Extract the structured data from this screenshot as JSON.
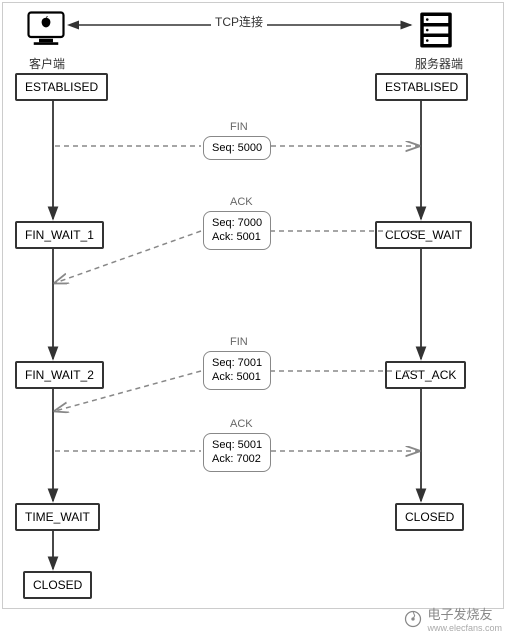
{
  "header": {
    "tcp_label": "TCP连接",
    "client_label": "客户端",
    "server_label": "服务器端"
  },
  "client_states": {
    "s0": "ESTABLISED",
    "s1": "FIN_WAIT_1",
    "s2": "FIN_WAIT_2",
    "s3": "TIME_WAIT",
    "s4": "CLOSED"
  },
  "server_states": {
    "s0": "ESTABLISED",
    "s1": "CLOSE_WAIT",
    "s2": "LAST_ACK",
    "s3": "CLOSED"
  },
  "messages": {
    "m1": {
      "flag": "FIN",
      "line1": "Seq: 5000"
    },
    "m2": {
      "flag": "ACK",
      "line1": "Seq: 7000",
      "line2": "Ack: 5001"
    },
    "m3": {
      "flag": "FIN",
      "line1": "Seq: 7001",
      "line2": "Ack: 5001"
    },
    "m4": {
      "flag": "ACK",
      "line1": "Seq: 5001",
      "line2": "Ack: 7002"
    }
  },
  "watermark": {
    "text": "电子发烧友",
    "url": "www.elecfans.com"
  }
}
